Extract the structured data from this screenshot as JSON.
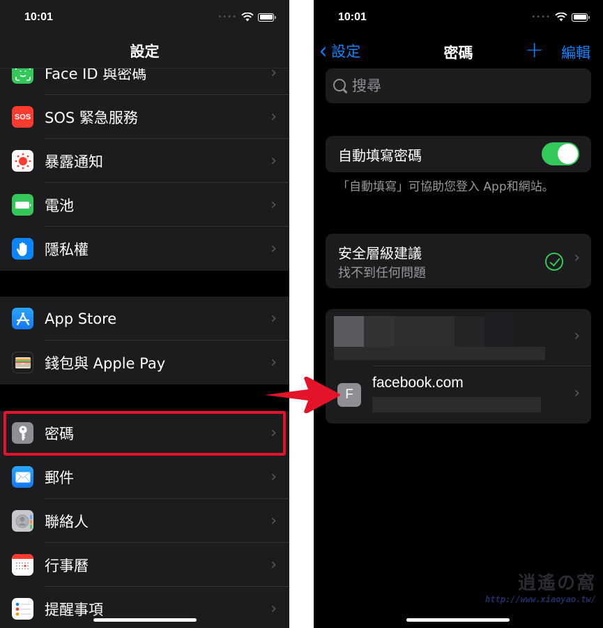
{
  "left_screen": {
    "status": {
      "time": "10:01"
    },
    "title": "設定",
    "groups": [
      {
        "items": [
          {
            "label": "Face ID 與密碼",
            "icon": "faceid-icon",
            "color": "#34c759"
          },
          {
            "label": "SOS 緊急服務",
            "icon": "sos-icon",
            "icon_text": "SOS",
            "color": "#ff3b30"
          },
          {
            "label": "暴露通知",
            "icon": "exposure-icon",
            "color": "#ffffff"
          },
          {
            "label": "電池",
            "icon": "battery-icon",
            "color": "#34c759"
          },
          {
            "label": "隱私權",
            "icon": "hand-icon",
            "color": "#0a84ff"
          }
        ]
      },
      {
        "items": [
          {
            "label": "App Store",
            "icon": "appstore-icon",
            "color": "#1e90ff"
          },
          {
            "label": "錢包與 Apple Pay",
            "icon": "wallet-icon",
            "color": "#1c1c1e"
          }
        ]
      },
      {
        "items": [
          {
            "label": "密碼",
            "icon": "key-icon",
            "color": "#8e8e93",
            "highlighted": true
          },
          {
            "label": "郵件",
            "icon": "mail-icon",
            "color": "#1a8cff"
          },
          {
            "label": "聯絡人",
            "icon": "contacts-icon",
            "color": "#c7c7cc"
          },
          {
            "label": "行事曆",
            "icon": "calendar-icon",
            "color": "#ffffff"
          },
          {
            "label": "提醒事項",
            "icon": "reminders-icon",
            "color": "#ffffff"
          }
        ]
      }
    ],
    "highlight_color": "#e3132a"
  },
  "right_screen": {
    "status": {
      "time": "10:01"
    },
    "nav": {
      "back_label": "設定",
      "title": "密碼",
      "add_symbol": "+",
      "edit_label": "編輯"
    },
    "search": {
      "placeholder": "搜尋",
      "value": ""
    },
    "autofill": {
      "label": "自動填寫密碼",
      "enabled": true
    },
    "footnote": "「自動填寫」可協助您登入 App和網站。",
    "security": {
      "title": "安全層級建議",
      "subtitle": "找不到任何問題",
      "status": "ok"
    },
    "accounts": [
      {
        "domain": "",
        "username": "",
        "redacted": true
      },
      {
        "domain": "facebook.com",
        "initial": "F",
        "username": "",
        "redacted_username": true
      }
    ],
    "accent_color": "#0a84ff",
    "toggle_color": "#34c759"
  },
  "annotation": {
    "arrow_color": "#e3132a"
  },
  "watermark": {
    "title": "逍遙の窩",
    "url": "http://www.xiaoyao.tw/"
  },
  "chevron": "›"
}
